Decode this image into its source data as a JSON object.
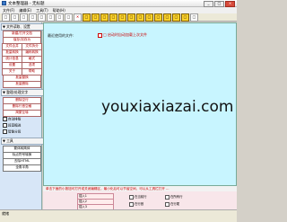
{
  "window": {
    "title": "文本整理器 - 无标题",
    "minimize": "_",
    "maximize": "□",
    "close": "×"
  },
  "menu": [
    "文件(F)",
    "编辑(E)",
    "工具(T)",
    "帮助(H)"
  ],
  "toolbar": [
    "□",
    "□",
    "□",
    "□",
    "□",
    "□",
    "□",
    "□",
    "✕",
    "□",
    "□",
    "□",
    "□",
    "□",
    "□",
    "□",
    "□",
    "□",
    "□",
    "□",
    "□",
    "□"
  ],
  "sidebar": {
    "panel1_title": "▼ 文件读取、设置",
    "panel1_items": [
      "新建/打开文档",
      "保存/另存为",
      "文件合并",
      "文件拆分",
      "批量转换",
      "编码转换",
      "统计信息",
      "格式",
      "设置",
      "选项",
      "关于",
      "帮助",
      "批量替换",
      "批量删除"
    ],
    "panel2_title": "▼ 整理/处理文字",
    "panel2_items": [
      "删除空行",
      "删除行首空格",
      "简繁互转"
    ],
    "checkboxes": [
      "自动排版",
      "段首缩进",
      "智能分段"
    ],
    "panel3_title": "▼ 工具",
    "panel3_items": [
      "繁体转简体",
      "标点符号转换",
      "去除HTML",
      "全角半角"
    ]
  },
  "editor": {
    "label": "最近使用的文件:",
    "option": "□ 启动时自动加载上次文件"
  },
  "watermark": "youxiaxiazai.com",
  "hint": "单击下面的小按钮可打开或关闭编辑区，最小化后可以节省空间，可以从工具栏打开 ...",
  "bottom": {
    "fields": [
      "插入1",
      "插入2",
      "插入3"
    ],
    "options": [
      "在当前行",
      "在所有行",
      "在行首",
      "在行尾"
    ]
  },
  "status": "就绪"
}
